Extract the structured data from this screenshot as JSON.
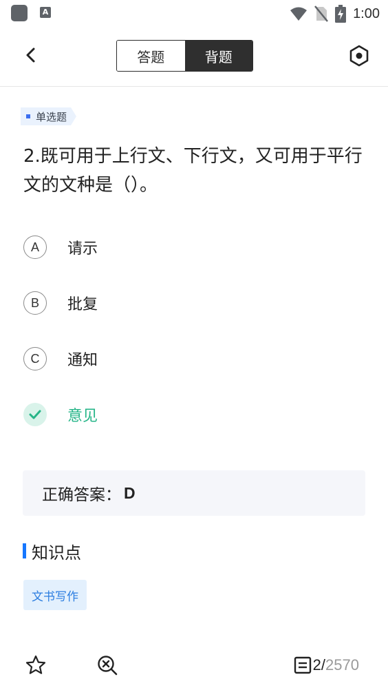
{
  "status_bar": {
    "time": "1:00",
    "a_icon_letter": "A",
    "icons": [
      "app-square-icon",
      "a-notification-icon",
      "wifi-icon",
      "no-sim-icon",
      "battery-charging-icon"
    ]
  },
  "header": {
    "back_icon": "chevron-left-icon",
    "tabs": [
      {
        "label": "答题",
        "active": false
      },
      {
        "label": "背题",
        "active": true
      }
    ],
    "settings_icon": "hexagon-settings-icon"
  },
  "question": {
    "type_label": "单选题",
    "text": "2.既可用于上行文、下行文，又可用于平行文的文种是（）。",
    "options": [
      {
        "letter": "A",
        "text": "请示",
        "correct": false
      },
      {
        "letter": "B",
        "text": "批复",
        "correct": false
      },
      {
        "letter": "C",
        "text": "通知",
        "correct": false
      },
      {
        "letter": "D",
        "text": "意见",
        "correct": true
      }
    ]
  },
  "answer": {
    "label": "正确答案：",
    "value": "D"
  },
  "knowledge": {
    "title": "知识点",
    "tags": [
      "文书写作"
    ]
  },
  "bottom_bar": {
    "star_icon": "star-icon",
    "zoom_icon": "zoom-cancel-icon",
    "list_icon": "list-icon",
    "current": "2",
    "separator": "/",
    "total": "2570"
  },
  "colors": {
    "accent_blue": "#1677ff",
    "correct_green": "#26b588",
    "tab_active_bg": "#2f2f2f"
  }
}
